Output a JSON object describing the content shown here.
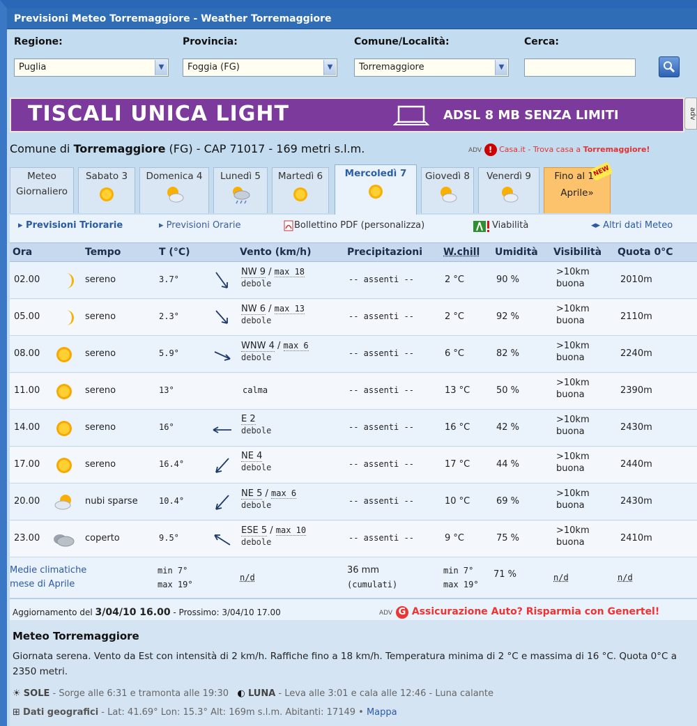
{
  "window": {
    "title": "Previsioni Meteo Torremaggiore - Weather Torremaggiore"
  },
  "selectors": {
    "regione": {
      "label": "Regione:",
      "value": "Puglia"
    },
    "provincia": {
      "label": "Provincia:",
      "value": "Foggia (FG)"
    },
    "comune": {
      "label": "Comune/Località:",
      "value": "Torremaggiore"
    },
    "cerca": {
      "label": "Cerca:",
      "value": ""
    }
  },
  "banner": {
    "brand": "TISCALI UNICA LIGHT",
    "offer": "ADSL 8 MB SENZA LIMITI",
    "adv": "adv"
  },
  "location": {
    "prefix": "Comune di ",
    "name": "Torremaggiore",
    "suffix": " (FG) - CAP 71017 - 169 metri s.l.m."
  },
  "casa_ad": {
    "adv": "ADV",
    "text": "Casa.it - Trova casa a ",
    "place": "Torremaggiore!"
  },
  "tabs": [
    {
      "line1": "Meteo",
      "line2": "Giornaliero"
    },
    {
      "line1": "Sabato 3",
      "icon": "sun-icon"
    },
    {
      "line1": "Domenica 4",
      "icon": "partly-cloudy-icon"
    },
    {
      "line1": "Lunedì 5",
      "icon": "cloud-rain-icon"
    },
    {
      "line1": "Martedì 6",
      "icon": "sun-icon"
    },
    {
      "line1": "Mercoledì 7",
      "icon": "sun-icon"
    },
    {
      "line1": "Giovedì 8",
      "icon": "partly-cloudy-icon"
    },
    {
      "line1": "Venerdì 9",
      "icon": "partly-cloudy-icon"
    },
    {
      "line1": "Fino al 17",
      "line2": "Aprile»",
      "badge": "NEW"
    }
  ],
  "links": {
    "triorarie": "▸ Previsioni Triorarie",
    "orarie": "▸ Previsioni Orarie",
    "bollettino": "Bollettino PDF (personalizza)",
    "viabilita": "Viabilità",
    "altri": "◂▸ Altri dati Meteo"
  },
  "table": {
    "headers": [
      "Ora",
      "Tempo",
      "T (°C)",
      "Vento (km/h)",
      "Precipitazioni",
      "W.chill",
      "Umidità",
      "Visibilità",
      "Quota 0°C"
    ],
    "rows": [
      {
        "ora": "02.00",
        "icon": "moon-icon",
        "tempo": "sereno",
        "t": "3.7°",
        "dir": "NW",
        "speed": "9",
        "max": "max 18",
        "forza": "debole",
        "precip": "-- assenti --",
        "wchill": "2 °C",
        "umid": "90 %",
        "vis1": ">10km",
        "vis2": "buona",
        "quota": "2010m"
      },
      {
        "ora": "05.00",
        "icon": "moon-icon",
        "tempo": "sereno",
        "t": "2.3°",
        "dir": "NW",
        "speed": "6",
        "max": "max 13",
        "forza": "debole",
        "precip": "-- assenti --",
        "wchill": "2 °C",
        "umid": "92 %",
        "vis1": ">10km",
        "vis2": "buona",
        "quota": "2110m"
      },
      {
        "ora": "08.00",
        "icon": "sun-icon",
        "tempo": "sereno",
        "t": "5.9°",
        "dir": "WNW",
        "speed": "4",
        "max": "max 6",
        "forza": "debole",
        "precip": "-- assenti --",
        "wchill": "6 °C",
        "umid": "82 %",
        "vis1": ">10km",
        "vis2": "buona",
        "quota": "2240m"
      },
      {
        "ora": "11.00",
        "icon": "sun-icon",
        "tempo": "sereno",
        "t": "13°",
        "calma": "calma",
        "precip": "-- assenti --",
        "wchill": "13 °C",
        "umid": "50 %",
        "vis1": ">10km",
        "vis2": "buona",
        "quota": "2390m"
      },
      {
        "ora": "14.00",
        "icon": "sun-icon",
        "tempo": "sereno",
        "t": "16°",
        "dir": "E",
        "speed": "2",
        "forza": "debole",
        "precip": "-- assenti --",
        "wchill": "16 °C",
        "umid": "42 %",
        "vis1": ">10km",
        "vis2": "buona",
        "quota": "2430m"
      },
      {
        "ora": "17.00",
        "icon": "sun-icon",
        "tempo": "sereno",
        "t": "16.4°",
        "dir": "NE",
        "speed": "4",
        "forza": "debole",
        "precip": "-- assenti --",
        "wchill": "17 °C",
        "umid": "44 %",
        "vis1": ">10km",
        "vis2": "buona",
        "quota": "2440m"
      },
      {
        "ora": "20.00",
        "icon": "partly-cloudy-icon",
        "tempo": "nubi sparse",
        "t": "10.4°",
        "dir": "NE",
        "speed": "5",
        "max": "max 6",
        "forza": "debole",
        "precip": "-- assenti --",
        "wchill": "10 °C",
        "umid": "69 %",
        "vis1": ">10km",
        "vis2": "buona",
        "quota": "2430m"
      },
      {
        "ora": "23.00",
        "icon": "overcast-icon",
        "tempo": "coperto",
        "t": "9.5°",
        "dir": "ESE",
        "speed": "5",
        "max": "max 10",
        "forza": "debole",
        "precip": "-- assenti --",
        "wchill": "9 °C",
        "umid": "75 %",
        "vis1": ">10km",
        "vis2": "buona",
        "quota": "2410m"
      }
    ]
  },
  "medie": {
    "label1": "Medie climatiche",
    "label2": "mese di Aprile",
    "tmin": "min 7°",
    "tmax": "max 19°",
    "vento": "n/d",
    "precip1": "36 mm",
    "precip2": "(cumulati)",
    "wmin": "min 7°",
    "wmax": "max 19°",
    "umid": "71 %",
    "vis": "n/d",
    "quota": "n/d"
  },
  "aggiornamento": {
    "prefix": "Aggiornamento del ",
    "date": "3/04/10 16.00",
    "next": " - Prossimo: 3/04/10 17.00"
  },
  "generali_ad": {
    "adv": "ADV",
    "logo": "G",
    "text": "Assicurazione Auto? Risparmia con Genertel!"
  },
  "summary": {
    "title": "Meteo Torremaggiore",
    "text": "Giornata serena. Vento da Est con intensità di 2 km/h. Raffiche fino a 18 km/h. Temperatura minima di 2 °C e massima di 16 °C. Quota 0°C a 2350 metri.",
    "sole_label": "SOLE",
    "sole_text": " - Sorge alle 6:31 e tramonta alle 19:30",
    "luna_label": "LUNA",
    "luna_text": " - Leva alle 3:01 e cala alle 12:46 - Luna calante",
    "geo_label": "Dati geografici",
    "geo_text": " - Lat: 41.69°  Lon: 15.3°  Alt: 169m s.l.m.  Abitanti: 17149 • ",
    "map_link": "Mappa"
  },
  "colors": {
    "accent": "#2f6db6",
    "banner": "#7c3b9c",
    "alert": "#e33333"
  }
}
